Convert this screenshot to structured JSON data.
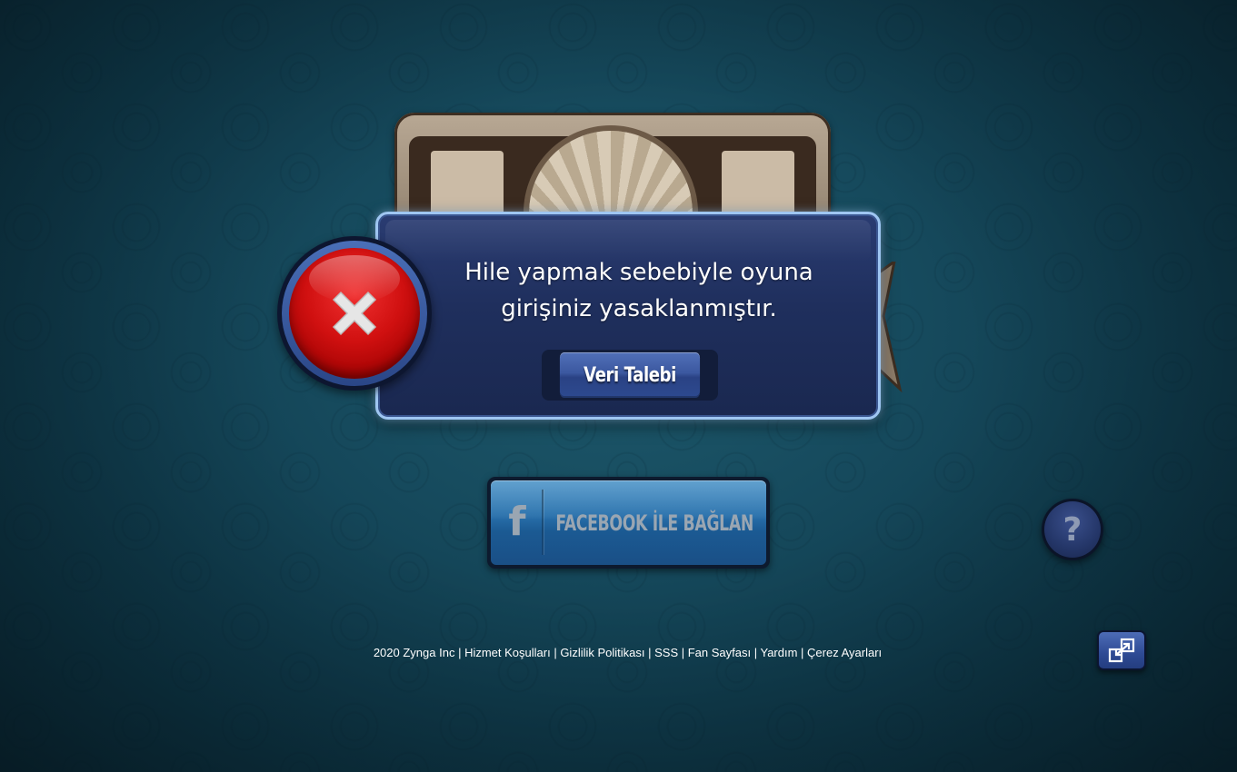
{
  "dialog": {
    "message": "Hile yapmak sebebiyle oyuna\ngirişiniz yasaklanmıştır.",
    "button_label": "Veri Talebi"
  },
  "facebook_button": {
    "icon": "facebook-icon",
    "label": "FACEBOOK İLE BAĞLAN"
  },
  "help_button": {
    "icon": "question-icon",
    "label": "?"
  },
  "footer": {
    "copyright": "2020 Zynga Inc",
    "links": [
      "Hizmet Koşulları",
      "Gizlilik Politikası",
      "SSS",
      "Fan Sayfası",
      "Yardım",
      "Çerez Ayarları"
    ],
    "separator": " | "
  },
  "fullscreen_button": {
    "icon": "fullscreen-expand-icon"
  },
  "colors": {
    "background": "#164a5d",
    "dialog_bg": "#1f2f5d",
    "dialog_border": "#9fc6f2",
    "error_red": "#d01010",
    "facebook_blue": "#2a72ad"
  }
}
